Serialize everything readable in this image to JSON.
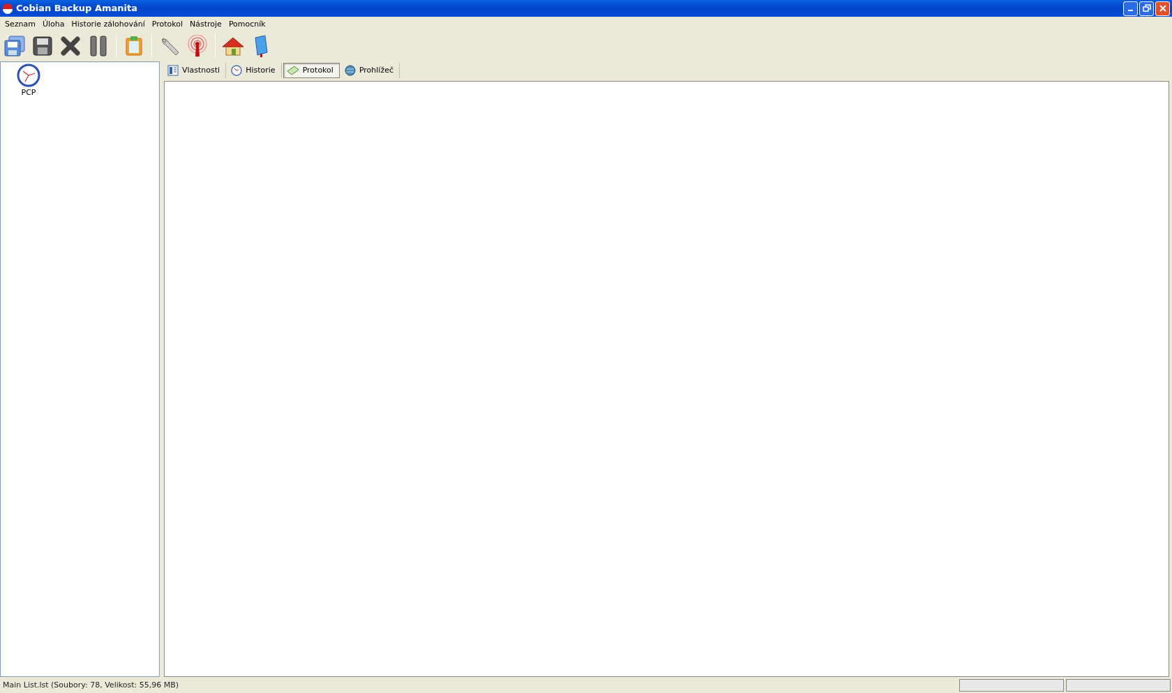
{
  "window": {
    "title": "Cobian Backup Amanita"
  },
  "menu": [
    "Seznam",
    "Úloha",
    "Historie zálohování",
    "Protokol",
    "Nástroje",
    "Pomocník"
  ],
  "sidebar": {
    "items": [
      {
        "label": "PCP",
        "selected": false
      }
    ]
  },
  "tabs": [
    {
      "kind": "properties",
      "label": "Vlastnosti",
      "selected": false
    },
    {
      "kind": "history",
      "label": "Historie",
      "selected": false
    },
    {
      "kind": "log",
      "label": "Protokol",
      "selected": true
    },
    {
      "kind": "browser",
      "label": "Prohlížeč",
      "selected": false
    }
  ],
  "status_bar": {
    "text": "Main List.lst (Soubory: 78, Velikost: 55,96 MB)"
  }
}
